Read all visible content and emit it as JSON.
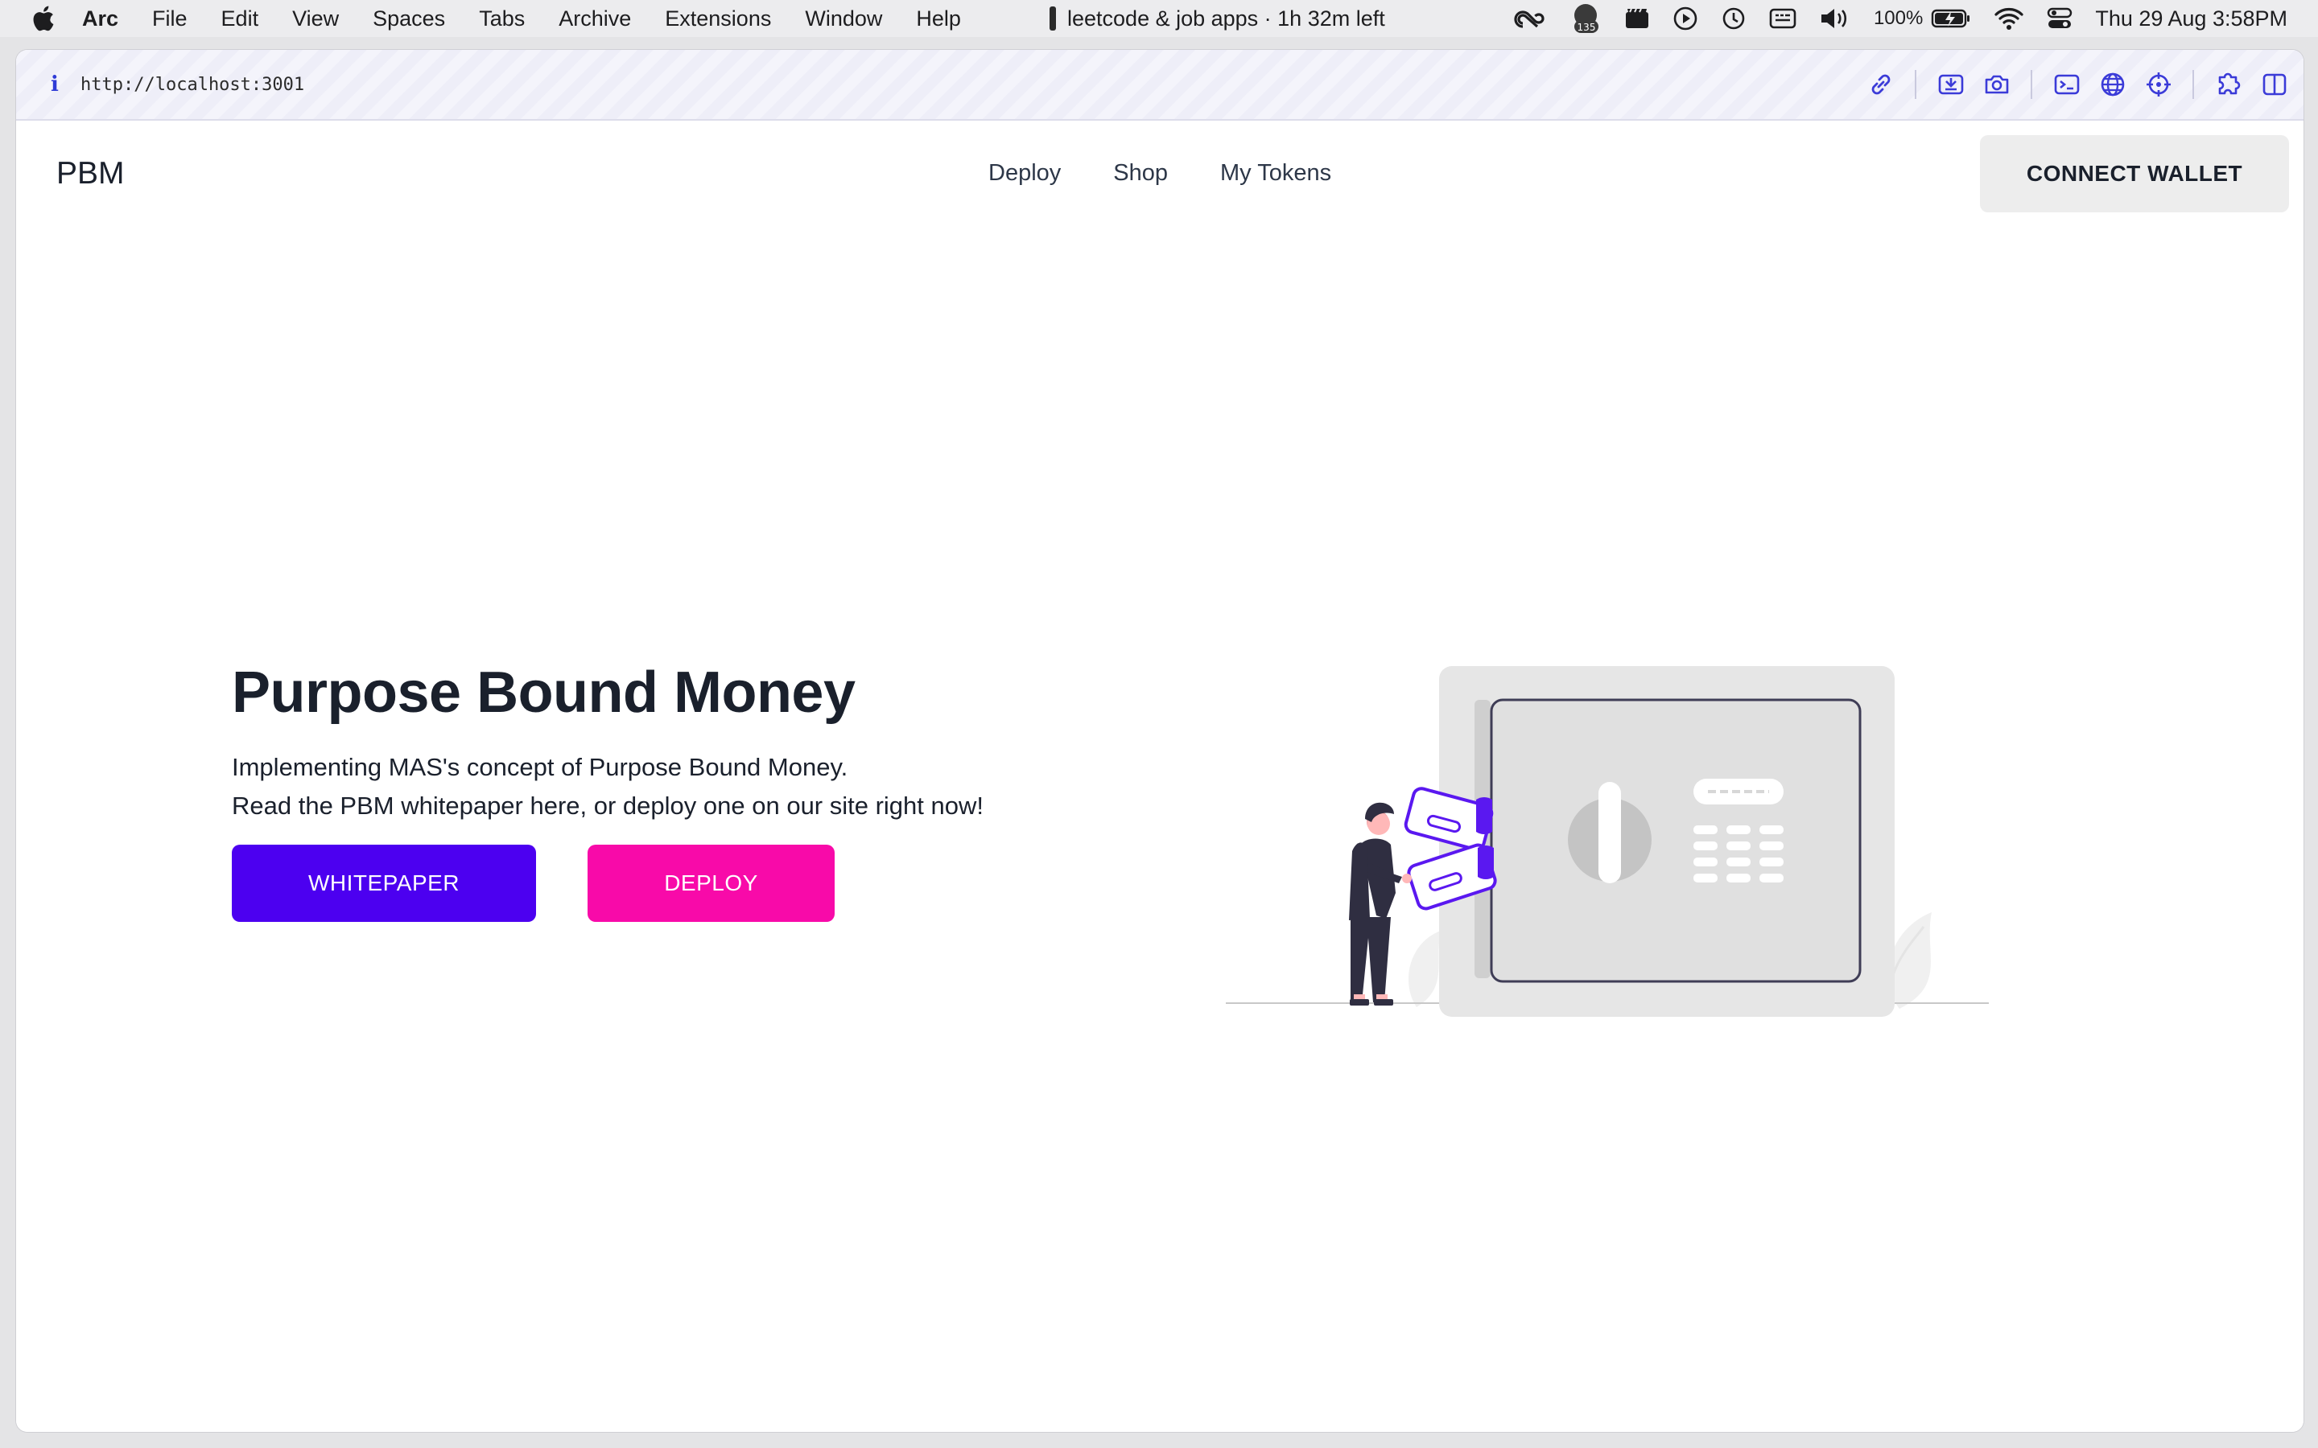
{
  "menubar": {
    "app_name": "Arc",
    "menus": [
      "File",
      "Edit",
      "View",
      "Spaces",
      "Tabs",
      "Archive",
      "Extensions",
      "Window",
      "Help"
    ],
    "focus_timer": "leetcode & job apps · 1h 32m left",
    "notification_count": "135",
    "battery": "100%",
    "datetime": "Thu 29 Aug  3:58PM"
  },
  "browser": {
    "url": "http://localhost:3001",
    "info_glyph": "i"
  },
  "nav": {
    "logo": "PBM",
    "links": [
      "Deploy",
      "Shop",
      "My Tokens"
    ],
    "connect_label": "CONNECT WALLET"
  },
  "hero": {
    "title": "Purpose Bound Money",
    "line1": "Implementing MAS's concept of Purpose Bound Money.",
    "line2": "Read the PBM whitepaper here, or deploy one on our site right now!",
    "whitepaper_label": "WHITEPAPER",
    "deploy_label": "DEPLOY"
  },
  "colors": {
    "primary": "#4c00f0",
    "accent": "#f80aa9",
    "illustration_purple": "#5a18f0"
  }
}
